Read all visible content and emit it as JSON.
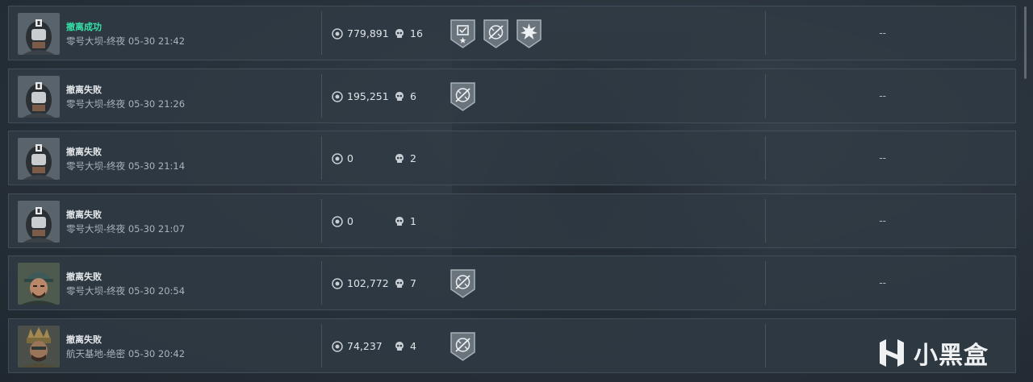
{
  "records": [
    {
      "status": "撤离成功",
      "success": true,
      "map": "零号大坝-终夜",
      "time": "05-30 21:42",
      "value": "779,891",
      "kills": "16",
      "badges": [
        "assault-badge-icon",
        "shotgun-badge-icon",
        "explosion-badge-icon"
      ],
      "extra": "--",
      "avatar": "masked-operator"
    },
    {
      "status": "撤离失败",
      "success": false,
      "map": "零号大坝-终夜",
      "time": "05-30 21:26",
      "value": "195,251",
      "kills": "6",
      "badges": [
        "shotgun-badge-icon"
      ],
      "extra": "--",
      "avatar": "masked-operator"
    },
    {
      "status": "撤离失败",
      "success": false,
      "map": "零号大坝-终夜",
      "time": "05-30 21:14",
      "value": "0",
      "kills": "2",
      "badges": [],
      "extra": "--",
      "avatar": "masked-operator"
    },
    {
      "status": "撤离失败",
      "success": false,
      "map": "零号大坝-终夜",
      "time": "05-30 21:07",
      "value": "0",
      "kills": "1",
      "badges": [],
      "extra": "--",
      "avatar": "masked-operator"
    },
    {
      "status": "撤离失败",
      "success": false,
      "map": "零号大坝-终夜",
      "time": "05-30 20:54",
      "value": "102,772",
      "kills": "7",
      "badges": [
        "shotgun-badge-icon"
      ],
      "extra": "--",
      "avatar": "cap-operator"
    },
    {
      "status": "撤离失败",
      "success": false,
      "map": "航天基地-绝密",
      "time": "05-30 20:42",
      "value": "74,237",
      "kills": "4",
      "badges": [
        "shotgun-badge-icon"
      ],
      "extra": "--",
      "avatar": "crown-operator"
    }
  ],
  "watermark": {
    "text": "小黑盒"
  },
  "colors": {
    "success": "#35e3a8",
    "row_bg": "#303a44",
    "text": "#e0e4e8",
    "muted": "#aab3bc"
  }
}
